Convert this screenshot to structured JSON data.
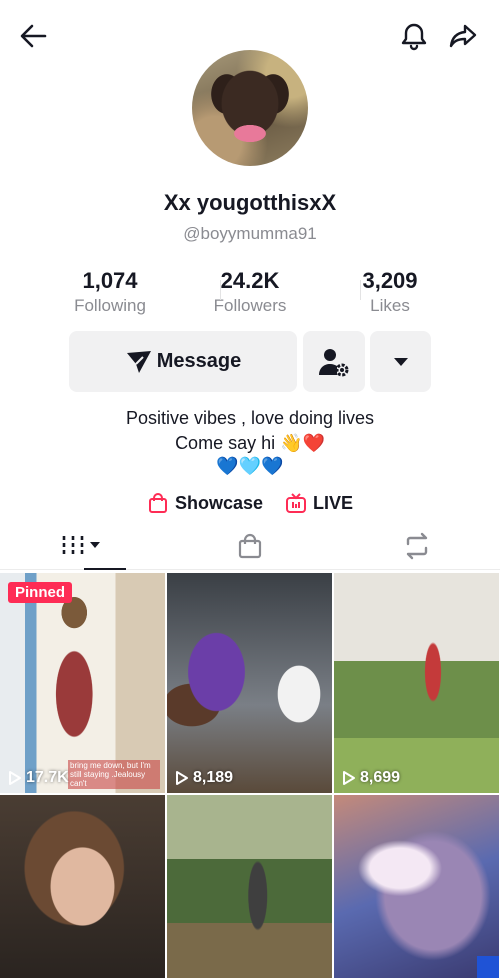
{
  "profile": {
    "display_name": "Xx yougotthisxX",
    "username": "@boyymumma91",
    "bio_line1": "Positive vibes , love doing lives",
    "bio_line2": "Come say hi 👋❤️",
    "bio_line3": "💙🩵💙"
  },
  "stats": [
    {
      "value": "1,074",
      "label": "Following"
    },
    {
      "value": "24.2K",
      "label": "Followers"
    },
    {
      "value": "3,209",
      "label": "Likes"
    }
  ],
  "actions": {
    "message_label": "Message"
  },
  "links": {
    "showcase_label": "Showcase",
    "live_label": "LIVE"
  },
  "videos": [
    {
      "views": "17.7K",
      "pinned_label": "Pinned",
      "caption": "bring me down, but I'm still staying .Jealousy can't"
    },
    {
      "views": "8,189"
    },
    {
      "views": "8,699"
    }
  ],
  "colors": {
    "accent": "#fe2c55",
    "text": "#161823",
    "muted": "#8a8b91",
    "button_bg": "#f1f1f2"
  },
  "icons": {
    "back": "arrow-left-icon",
    "bell": "bell-icon",
    "share": "share-arrow-icon",
    "send": "paper-plane-icon",
    "follow_settings": "user-gear-icon",
    "more": "caret-down-icon",
    "showcase": "shopping-bag-icon",
    "live": "live-tv-icon",
    "videos_tab": "grid-bars-icon",
    "shop_tab": "bag-icon",
    "repost_tab": "repost-icon",
    "play": "play-icon"
  }
}
